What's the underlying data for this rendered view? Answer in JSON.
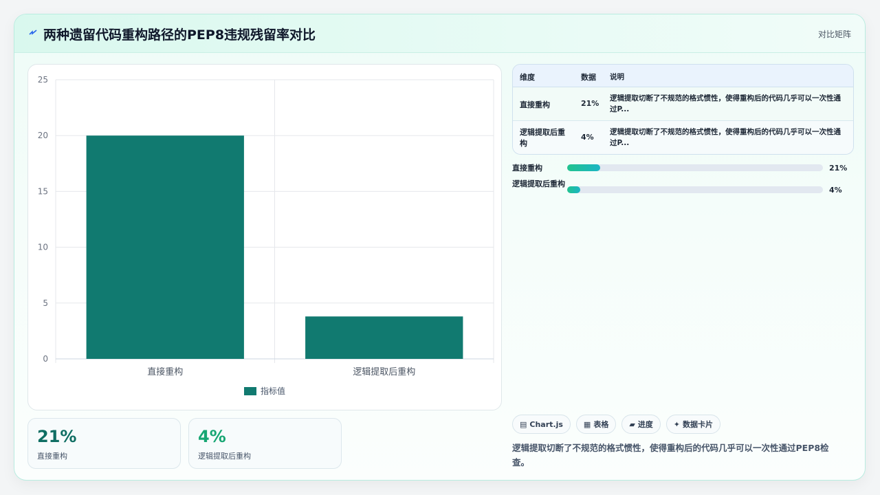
{
  "header": {
    "title": "两种遗留代码重构路径的PEP8违规残留率对比",
    "right_link": "对比矩阵",
    "icon": "lightning-icon"
  },
  "colors": {
    "bar": "#117a70",
    "accent": "#17a673",
    "progress_start": "#22c38e",
    "progress_end": "#1bb5c4"
  },
  "chart_data": {
    "type": "bar",
    "categories": [
      "直接重构",
      "逻辑提取后重构"
    ],
    "series": [
      {
        "name": "指标值",
        "values": [
          20,
          3.8
        ]
      }
    ],
    "ylim": [
      0,
      25
    ],
    "yticks": [
      0,
      5,
      10,
      15,
      20,
      25
    ],
    "grid": true,
    "legend_position": "bottom"
  },
  "stats": [
    {
      "value": "21%",
      "label": "直接重构"
    },
    {
      "value": "4%",
      "label": "逻辑提取后重构"
    }
  ],
  "table": {
    "headers": [
      "维度",
      "数据",
      "说明"
    ],
    "rows": [
      {
        "dim": "直接重构",
        "value": "21%",
        "desc": "逻辑提取切断了不规范的格式惯性，使得重构后的代码几乎可以一次性通过P..."
      },
      {
        "dim": "逻辑提取后重构",
        "value": "4%",
        "desc": "逻辑提取切断了不规范的格式惯性，使得重构后的代码几乎可以一次性通过P..."
      }
    ]
  },
  "progress": [
    {
      "label": "直接重构",
      "value": "21%",
      "fraction": 0.13
    },
    {
      "label": "逻辑提取后重构",
      "value": "4%",
      "fraction": 0.05
    }
  ],
  "chips": [
    {
      "icon": "chart-icon",
      "glyph": "▤",
      "label": "Chart.js"
    },
    {
      "icon": "table-icon",
      "glyph": "▦",
      "label": "表格"
    },
    {
      "icon": "progress-icon",
      "glyph": "▰",
      "label": "进度"
    },
    {
      "icon": "sparkle-icon",
      "glyph": "✦",
      "label": "数据卡片"
    }
  ],
  "footer": "逻辑提取切断了不规范的格式惯性，使得重构后的代码几乎可以一次性通过PEP8检查。"
}
